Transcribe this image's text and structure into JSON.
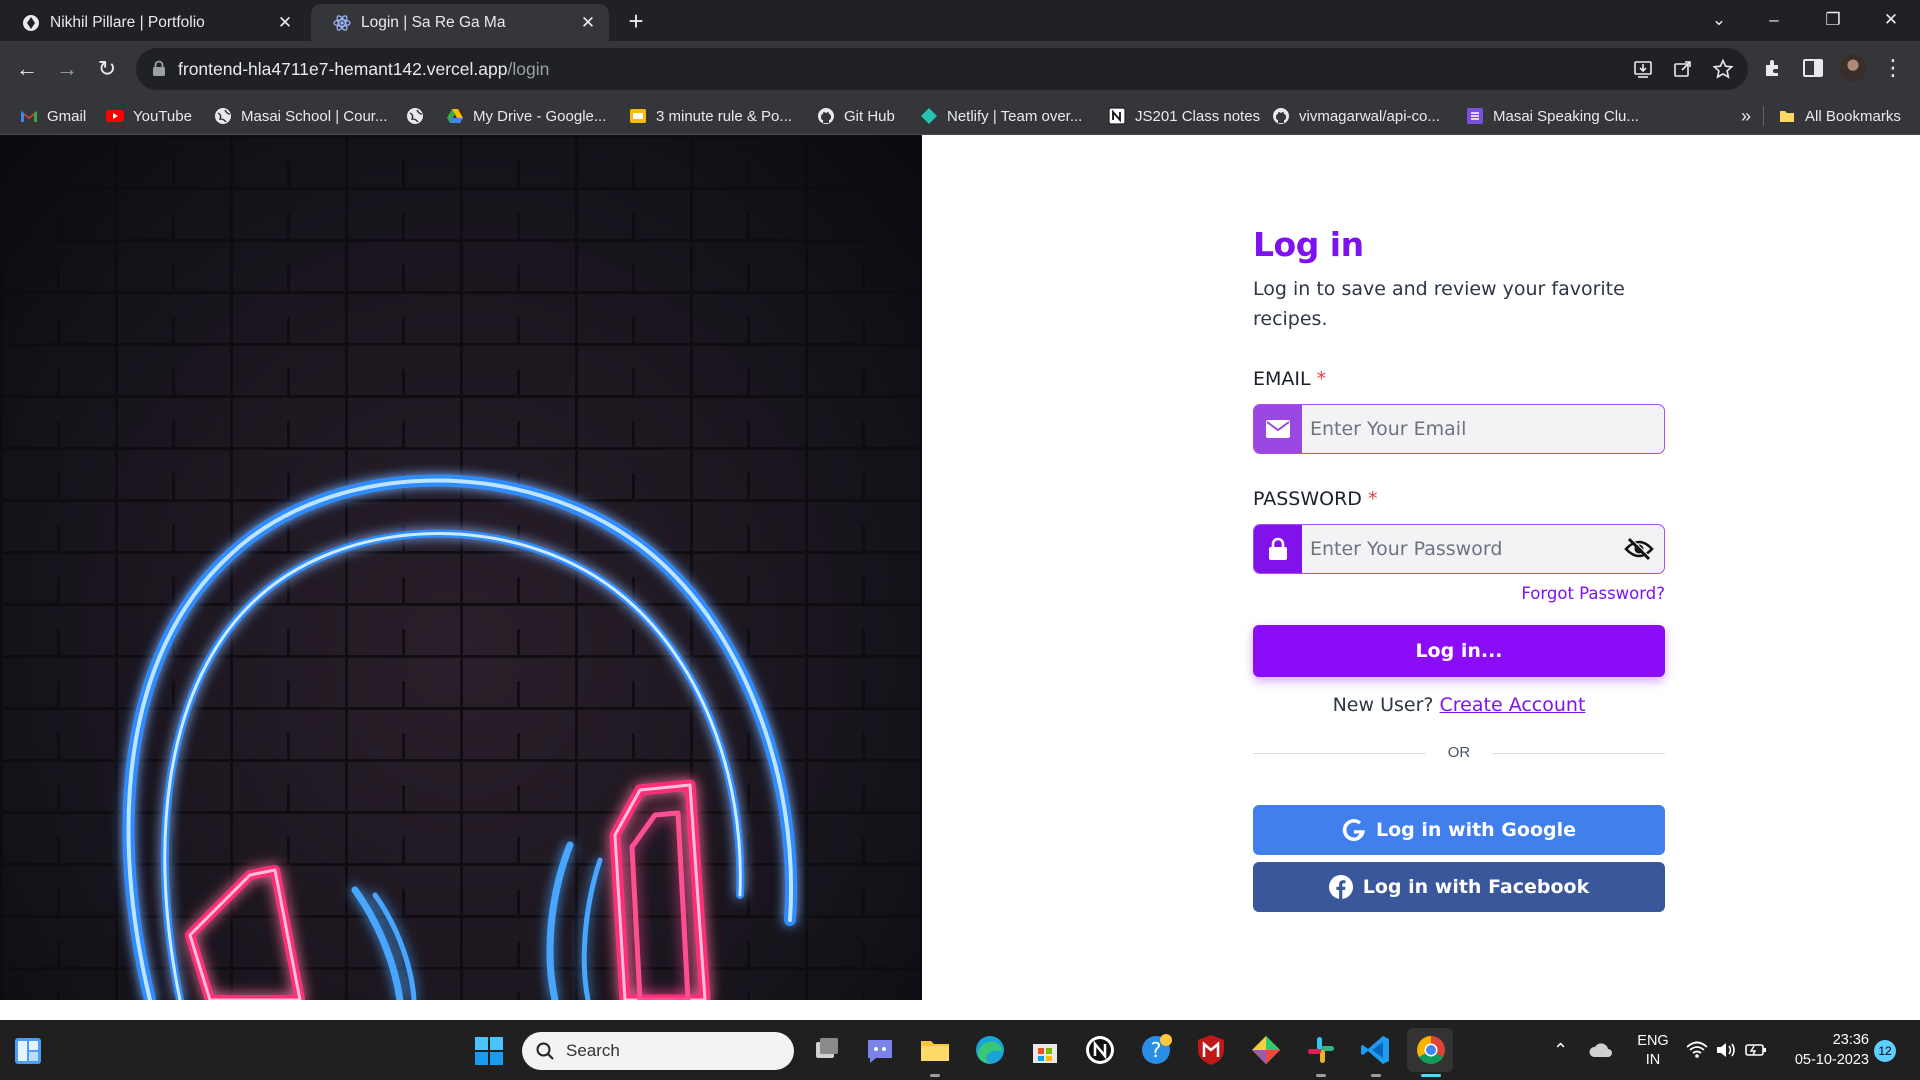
{
  "browser": {
    "tabs": [
      {
        "title": "Nikhil Pillare | Portfolio",
        "active": false
      },
      {
        "title": "Login | Sa Re Ga Ma",
        "active": true
      }
    ],
    "url_host": "frontend-hla4711e7-hemant142.vercel.app",
    "url_path": "/login",
    "bookmarks": [
      {
        "label": "Gmail",
        "icon": "gmail-icon"
      },
      {
        "label": "YouTube",
        "icon": "youtube-icon"
      },
      {
        "label": "Masai School | Cour...",
        "icon": "globe-icon"
      },
      {
        "label": "",
        "icon": "globe-icon"
      },
      {
        "label": "My Drive - Google...",
        "icon": "drive-icon"
      },
      {
        "label": "3 minute rule & Po...",
        "icon": "slides-icon"
      },
      {
        "label": "Git Hub",
        "icon": "github-icon"
      },
      {
        "label": "Netlify | Team over...",
        "icon": "netlify-icon"
      },
      {
        "label": "JS201 Class notes",
        "icon": "notion-icon"
      },
      {
        "label": "vivmagarwal/api-co...",
        "icon": "github-icon"
      },
      {
        "label": "Masai Speaking Clu...",
        "icon": "list-icon"
      }
    ],
    "more_bookmarks": "»",
    "all_bookmarks": "All Bookmarks"
  },
  "login": {
    "title": "Log in",
    "subtitle": "Log in to save and review your favorite recipes.",
    "email_label": "EMAIL",
    "email_placeholder": "Enter Your Email",
    "password_label": "PASSWORD",
    "password_placeholder": "Enter Your Password",
    "required_mark": "*",
    "forgot": "Forgot Password?",
    "submit": "Log in...",
    "new_user": "New User?",
    "create_account": "Create Account",
    "or": "OR",
    "google": "Log in with Google",
    "facebook": "Log in with Facebook"
  },
  "taskbar": {
    "search_placeholder": "Search",
    "lang_top": "ENG",
    "lang_bottom": "IN",
    "time": "23:36",
    "date": "05-10-2023",
    "notifications": "12"
  },
  "colors": {
    "accent": "#7e12f0",
    "button": "#8d0cf7",
    "google": "#4180ec",
    "facebook": "#3a579b"
  }
}
